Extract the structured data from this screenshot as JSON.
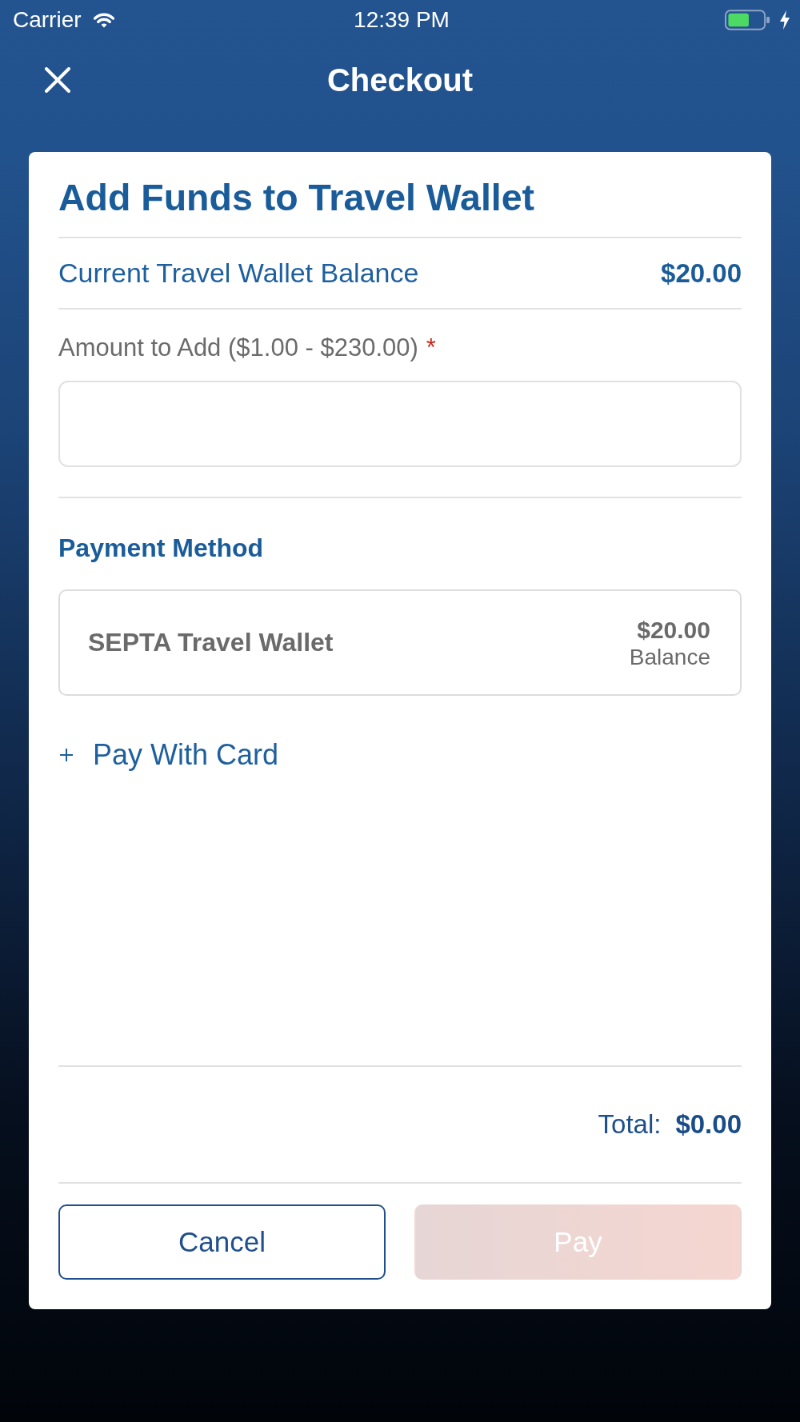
{
  "status_bar": {
    "carrier": "Carrier",
    "time": "12:39 PM"
  },
  "nav_bar": {
    "title": "Checkout"
  },
  "card": {
    "title": "Add Funds to Travel Wallet",
    "balance": {
      "label": "Current Travel Wallet Balance",
      "value": "$20.00"
    },
    "amount": {
      "label": "Amount to Add ($1.00 - $230.00)",
      "required_mark": "*"
    },
    "payment": {
      "heading": "Payment Method",
      "methods": [
        {
          "name": "SEPTA Travel Wallet",
          "amount": "$20.00",
          "amount_label": "Balance",
          "selected": false
        }
      ],
      "add_link": "Pay With Card"
    },
    "total": {
      "label": "Total:",
      "value": "$0.00"
    },
    "buttons": [
      {
        "kind": "secondary",
        "label": "Cancel",
        "disabled": false
      },
      {
        "kind": "primary",
        "label": "Pay",
        "disabled": true
      }
    ]
  }
}
